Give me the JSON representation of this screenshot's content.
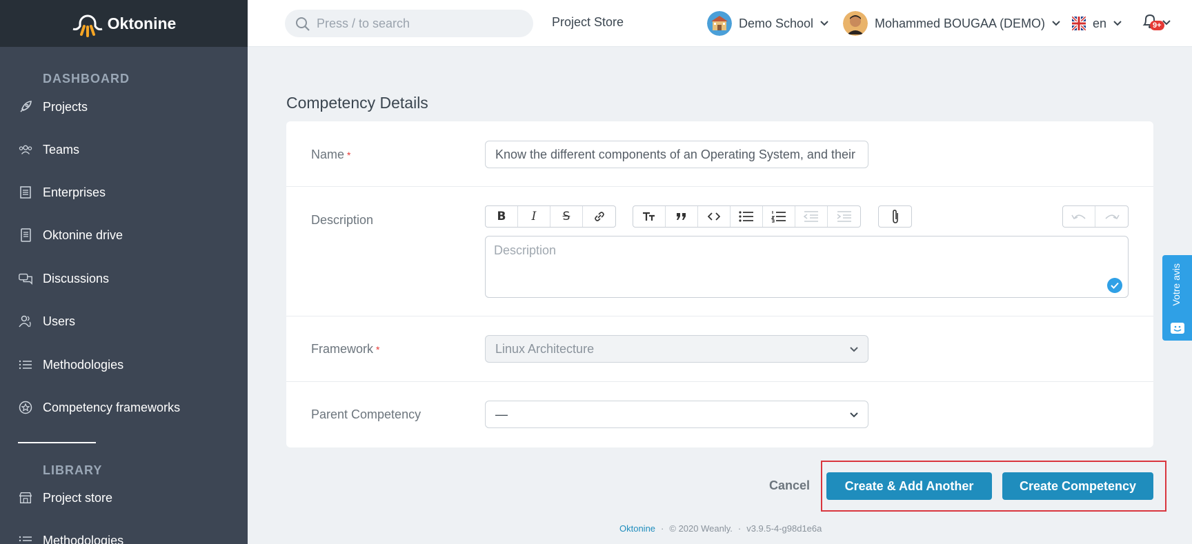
{
  "app": {
    "logo_text": "Oktonine"
  },
  "sidebar": {
    "sections": [
      {
        "title": "DASHBOARD"
      },
      {
        "title": "LIBRARY"
      }
    ],
    "items": [
      {
        "label": "Projects",
        "icon": "rocket-icon"
      },
      {
        "label": "Teams",
        "icon": "team-icon"
      },
      {
        "label": "Enterprises",
        "icon": "enterprise-icon"
      },
      {
        "label": "Oktonine drive",
        "icon": "drive-icon"
      },
      {
        "label": "Discussions",
        "icon": "chat-icon"
      },
      {
        "label": "Users",
        "icon": "users-icon"
      },
      {
        "label": "Methodologies",
        "icon": "list-icon"
      },
      {
        "label": "Competency frameworks",
        "icon": "badge-icon"
      }
    ],
    "library_items": [
      {
        "label": "Project store",
        "icon": "store-icon"
      },
      {
        "label": "Methodologies",
        "icon": "list-icon"
      }
    ]
  },
  "topbar": {
    "search_placeholder": "Press / to search",
    "project_store": "Project Store",
    "school": "Demo School",
    "user": "Mohammed BOUGAA (DEMO)",
    "language": "en",
    "notifications_badge": "9+"
  },
  "main": {
    "title": "Competency Details",
    "fields": {
      "name_label": "Name",
      "name_value": "Know the different components of an Operating System, and their",
      "description_label": "Description",
      "description_placeholder": "Description",
      "framework_label": "Framework",
      "framework_value": "Linux Architecture",
      "parent_label": "Parent Competency",
      "parent_value": "—",
      "required_mark": "*"
    },
    "actions": {
      "cancel": "Cancel",
      "create_add_another": "Create & Add Another",
      "create": "Create Competency"
    }
  },
  "footer": {
    "brand": "Oktonine",
    "copyright": "© 2020 Weanly.",
    "version": "v3.9.5-4-g98d1e6a",
    "separator": "·"
  },
  "feedback": {
    "label": "Votre avis"
  },
  "colors": {
    "sidebar": "#3d4654",
    "primary": "#1f8dbd",
    "highlight": "#d9363e"
  }
}
